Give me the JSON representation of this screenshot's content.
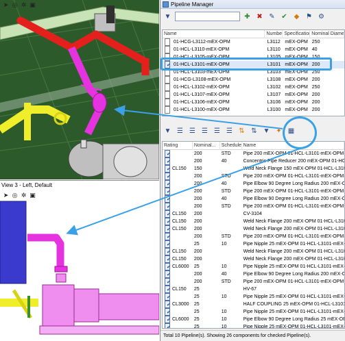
{
  "colors": {
    "callout": "#3aa0e8",
    "ground": "#2d5a2a",
    "pipe_red": "#e4201d",
    "pipe_magenta": "#e533e0",
    "pipe_yellow": "#f0ee2a",
    "equipment_gray": "#bfbfbf",
    "equipment_pink": "#f08ef0",
    "vessel_blue": "#3a3acd"
  },
  "view_top": {
    "toolbar_icons": [
      "cursor-icon",
      "orbit-icon",
      "sun-icon",
      "view-icon"
    ]
  },
  "view_bottom": {
    "title": "View 3 - Left, Default",
    "toolbar_icons": [
      "cursor-icon",
      "orbit-icon",
      "sun-icon",
      "view-icon"
    ]
  },
  "pipeline_manager": {
    "title": "Pipeline Manager",
    "search_value": "",
    "toolbar_icons": [
      "filter-icon",
      "add-icon",
      "delete-icon",
      "edit-icon",
      "check-icon",
      "color-icon",
      "tag-icon",
      "settings-icon"
    ],
    "columns": [
      "Name",
      "Number",
      "Specification",
      "Nominal Diameter"
    ],
    "pipelines": [
      {
        "checked": false,
        "name": "01-HCG-L3112-mEX-OPM",
        "number": "L3112",
        "spec": "mEX-OPM",
        "diameter": "250"
      },
      {
        "checked": false,
        "name": "01-HCL-L3110-mEX-OPM",
        "number": "L3110",
        "spec": "mEX-OPM",
        "diameter": "40"
      },
      {
        "checked": false,
        "name": "01-HCL-L3105-mEX-OPM",
        "number": "L3105",
        "spec": "mEX-OPM",
        "diameter": "150"
      },
      {
        "checked": true,
        "name": "01-HCL-L3101-mEX-OPM",
        "number": "L3101",
        "spec": "mEX-OPM",
        "diameter": "200",
        "selected": true
      },
      {
        "checked": false,
        "name": "01-HCL-L3103-mEX-OPM",
        "number": "L3103",
        "spec": "mEX-OPM",
        "diameter": "250"
      },
      {
        "checked": false,
        "name": "01-HCG-L3108-mEX-OPM",
        "number": "L3108",
        "spec": "mEX-OPM",
        "diameter": "200"
      },
      {
        "checked": false,
        "name": "01-HCL-L3102-mEX-OPM",
        "number": "L3102",
        "spec": "mEX-OPM",
        "diameter": "250"
      },
      {
        "checked": false,
        "name": "01-HCL-L3107-mEX-OPM",
        "number": "L3107",
        "spec": "mEX-OPM",
        "diameter": "200"
      },
      {
        "checked": false,
        "name": "01-HCL-L3106-mEX-OPM",
        "number": "L3106",
        "spec": "mEX-OPM",
        "diameter": "200"
      },
      {
        "checked": false,
        "name": "01-HCL-L3100-mEX-OPM",
        "number": "L3100",
        "spec": "mEX-OPM",
        "diameter": "200"
      }
    ],
    "component_toolbar_icons": [
      "filter-icon",
      "list-icon",
      "list-icon",
      "list-icon",
      "list-icon",
      "list-icon",
      "sort-icon",
      "sort-icon",
      "filter-icon",
      "highlight-icon",
      "grid-icon"
    ],
    "component_columns": [
      "Rating",
      "Nominal...",
      "Schedule",
      "Name"
    ],
    "components": [
      {
        "checked": true,
        "rating": "",
        "nominal": "200",
        "schedule": "STD",
        "name": "Pipe 200 mEX-OPM 01-HCL-L3101-mEX-OPM"
      },
      {
        "checked": true,
        "rating": "",
        "nominal": "200",
        "schedule": "40",
        "name": "Concentric Pipe Reducer 200 mEX-OPM 01-HCL-L3..."
      },
      {
        "checked": true,
        "rating": "CL150",
        "nominal": "150",
        "schedule": "",
        "name": "Weld Neck Flange 150 mEX-OPM 01-HCL-L3101-m..."
      },
      {
        "checked": true,
        "rating": "",
        "nominal": "200",
        "schedule": "STD",
        "name": "Pipe 200 mEX-OPM 01-HCL-L3101-mEX-OPM"
      },
      {
        "checked": true,
        "rating": "",
        "nominal": "200",
        "schedule": "40",
        "name": "Pipe Elbow 90 Degree Long Radius 200 mEX-OPM..."
      },
      {
        "checked": true,
        "rating": "",
        "nominal": "200",
        "schedule": "STD",
        "name": "Pipe 200 mEX-OPM 01-HCL-L3101-mEX-OPM"
      },
      {
        "checked": true,
        "rating": "",
        "nominal": "200",
        "schedule": "40",
        "name": "Pipe Elbow 90 Degree Long Radius 200 mEX-OPM..."
      },
      {
        "checked": true,
        "rating": "",
        "nominal": "200",
        "schedule": "STD",
        "name": "Pipe 200 mEX-OPM 01-HCL-L3101-mEX-OPM"
      },
      {
        "checked": true,
        "rating": "CL150",
        "nominal": "200",
        "schedule": "",
        "name": "CV-3104"
      },
      {
        "checked": true,
        "rating": "CL150",
        "nominal": "200",
        "schedule": "",
        "name": "Weld Neck Flange 200 mEX-OPM 01-HCL-L3101-m..."
      },
      {
        "checked": true,
        "rating": "CL150",
        "nominal": "200",
        "schedule": "",
        "name": "Weld Neck Flange 200 mEX-OPM 01-HCL-L3101-m..."
      },
      {
        "checked": true,
        "rating": "",
        "nominal": "200",
        "schedule": "STD",
        "name": "Pipe 200 mEX-OPM 01-HCL-L3101-mEX-OPM"
      },
      {
        "checked": true,
        "rating": "",
        "nominal": "25",
        "schedule": "10",
        "name": "Pipe Nipple 25 mEX-OPM 01-HCL-L3101-mEX-OPM"
      },
      {
        "checked": true,
        "rating": "CL150",
        "nominal": "200",
        "schedule": "",
        "name": "Weld Neck Flange 200 mEX-OPM 01-HCL-L3101-m..."
      },
      {
        "checked": true,
        "rating": "CL150",
        "nominal": "200",
        "schedule": "",
        "name": "Weld Neck Flange 200 mEX-OPM 01-HCL-L3101-m..."
      },
      {
        "checked": true,
        "rating": "CL6000",
        "nominal": "25",
        "schedule": "10",
        "name": "Pipe Nipple 25 mEX-OPM 01-HCL-L3101-mEX-OPM"
      },
      {
        "checked": true,
        "rating": "",
        "nominal": "200",
        "schedule": "40",
        "name": "Pipe Elbow 90 Degree Long Radius 200 mEX-OPM..."
      },
      {
        "checked": true,
        "rating": "",
        "nominal": "200",
        "schedule": "STD",
        "name": "Pipe 200 mEX-OPM 01-HCL-L3101-mEX-OPM"
      },
      {
        "checked": true,
        "rating": "CL150",
        "nominal": "25",
        "schedule": "",
        "name": "HV-67"
      },
      {
        "checked": true,
        "rating": "",
        "nominal": "25",
        "schedule": "10",
        "name": "Pipe Nipple 25 mEX-OPM 01-HCL-L3101-mEX-OPM"
      },
      {
        "checked": true,
        "rating": "CL3000",
        "nominal": "25",
        "schedule": "",
        "name": "HALF COUPLING 25 mEX-OPM 01-HCL-L3101-mEX..."
      },
      {
        "checked": true,
        "rating": "",
        "nominal": "25",
        "schedule": "10",
        "name": "Pipe Nipple 25 mEX-OPM 01-HCL-L3101-mEX-OPM"
      },
      {
        "checked": true,
        "rating": "CL6000",
        "nominal": "25",
        "schedule": "10",
        "name": "Pipe Elbow 90 Degree Long Radius 25 mEX-OPM 0..."
      },
      {
        "checked": true,
        "rating": "",
        "nominal": "25",
        "schedule": "10",
        "name": "Pipe Nipple 25 mEX-OPM 01-HCL-L3101-mEX-OPM"
      },
      {
        "checked": true,
        "rating": "CL150",
        "nominal": "25",
        "schedule": "",
        "name": "HV-69"
      }
    ],
    "status": "Total 10 Pipeline(s). Showing 26 components for checked Pipeline(s)."
  }
}
